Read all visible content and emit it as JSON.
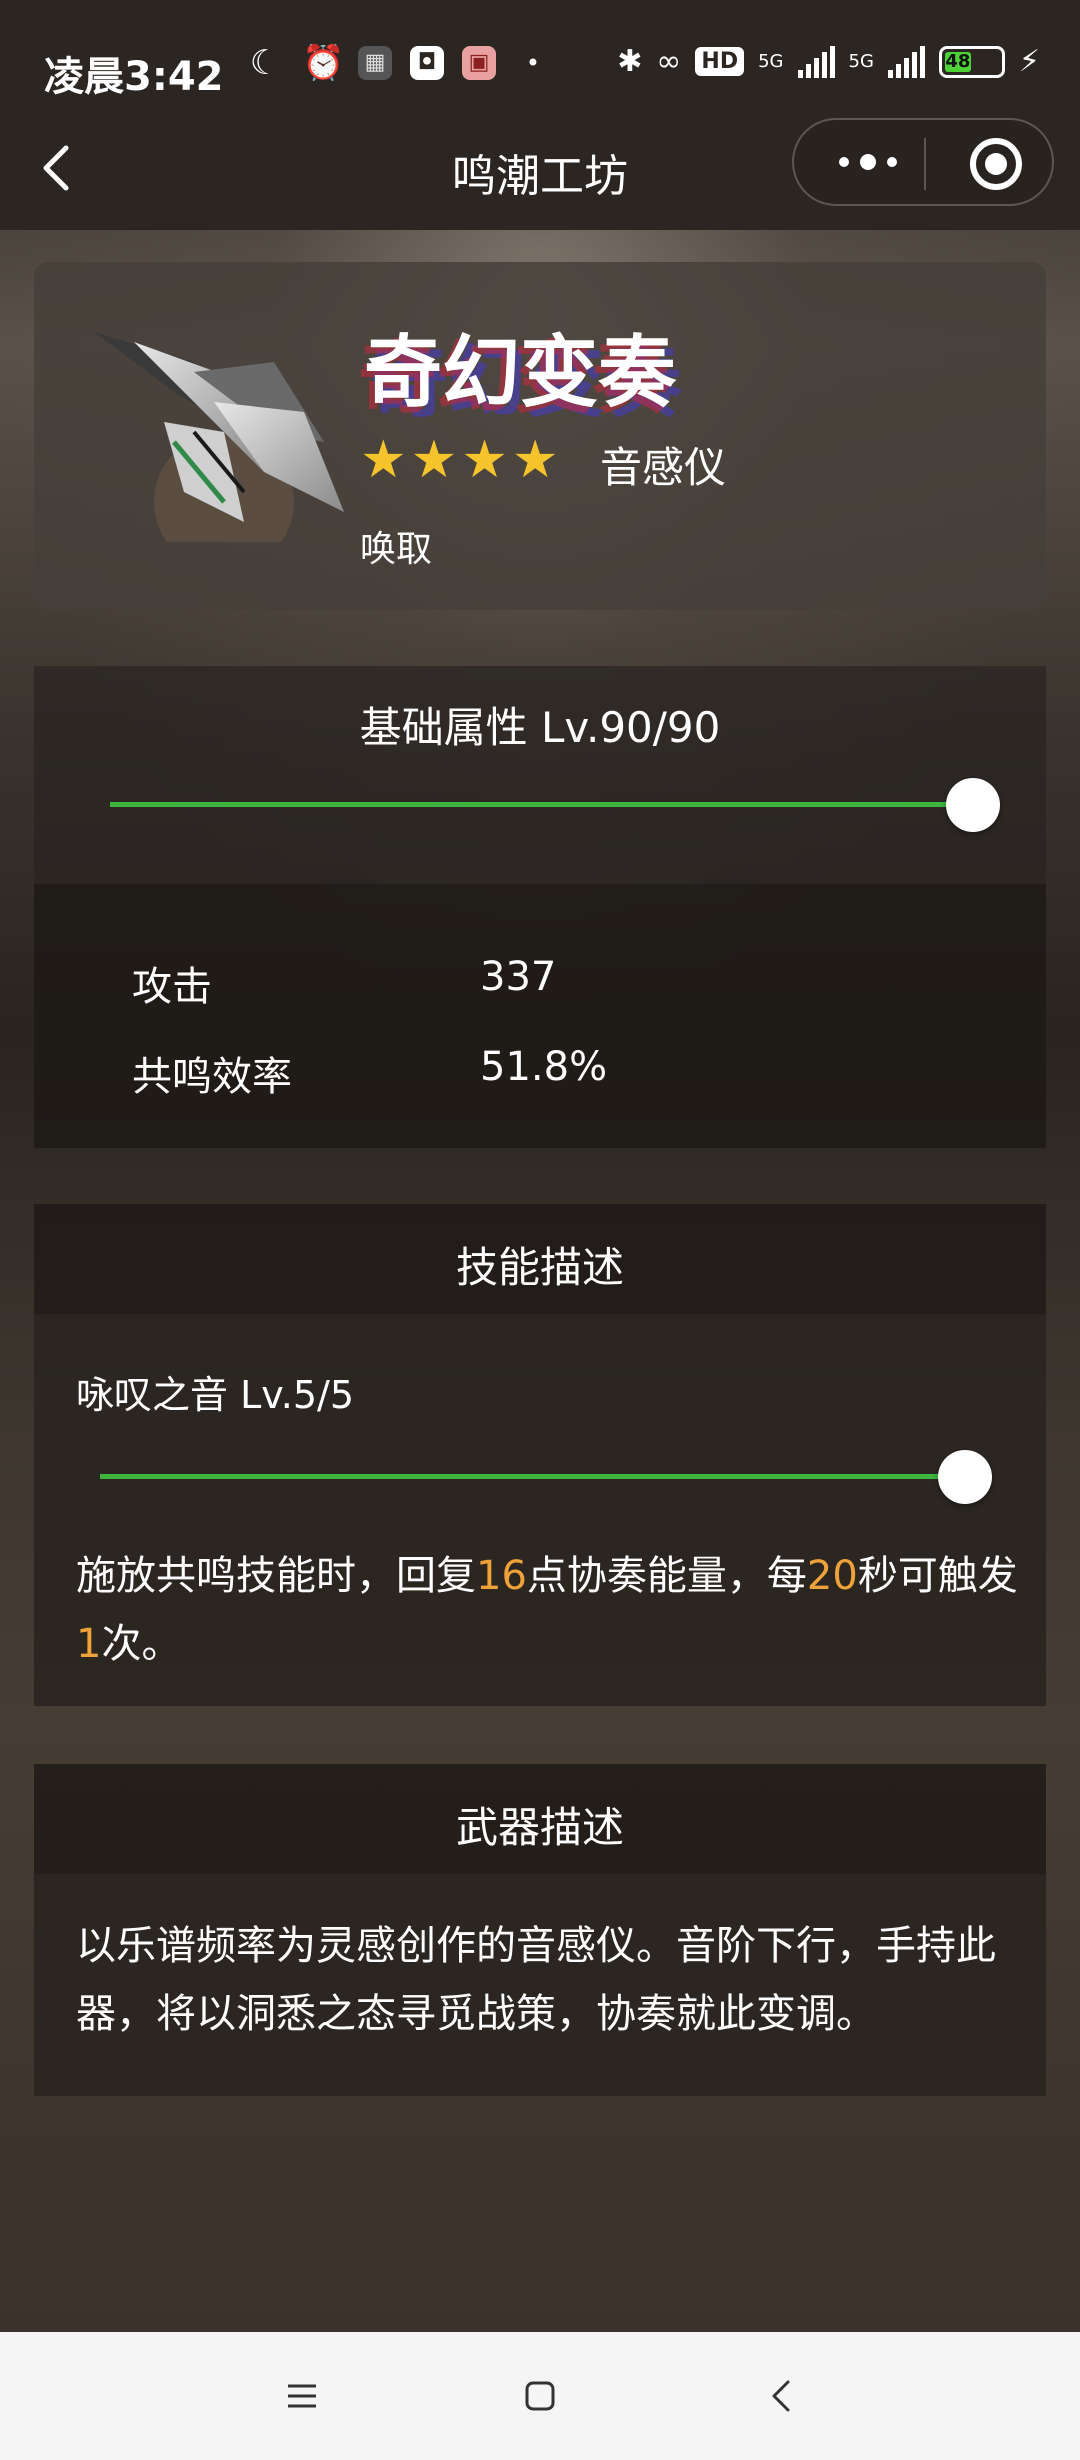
{
  "status_bar": {
    "time": "凌晨3:42",
    "battery_level": "48",
    "network_1": "5G",
    "network_2": "5G",
    "hd_label": "HD"
  },
  "nav": {
    "title": "鸣潮工坊"
  },
  "weapon": {
    "name": "奇幻变奏",
    "rarity_stars": 4,
    "type": "音感仪",
    "tag": "唤取"
  },
  "base_attributes": {
    "title": "基础属性 Lv.90/90",
    "level": 90,
    "max_level": 90,
    "stats": [
      {
        "label": "攻击",
        "value": "337"
      },
      {
        "label": "共鸣效率",
        "value": "51.8%"
      }
    ]
  },
  "skill": {
    "section_title": "技能描述",
    "name": "咏叹之音 Lv.5/5",
    "level": 5,
    "max_level": 5,
    "desc_parts": [
      "施放共鸣技能时，回复",
      "16",
      "点协奏能量，每",
      "20",
      "秒可触发",
      "1",
      "次。"
    ]
  },
  "weapon_description": {
    "section_title": "武器描述",
    "text": "以乐谱频率为灵感创作的音感仪。音阶下行，手持此器，将以洞悉之态寻觅战策，协奏就此变调。"
  },
  "colors": {
    "accent_orange": "#f0a23a",
    "slider_green": "#3fb53f",
    "star_gold": "#f5c32c"
  }
}
